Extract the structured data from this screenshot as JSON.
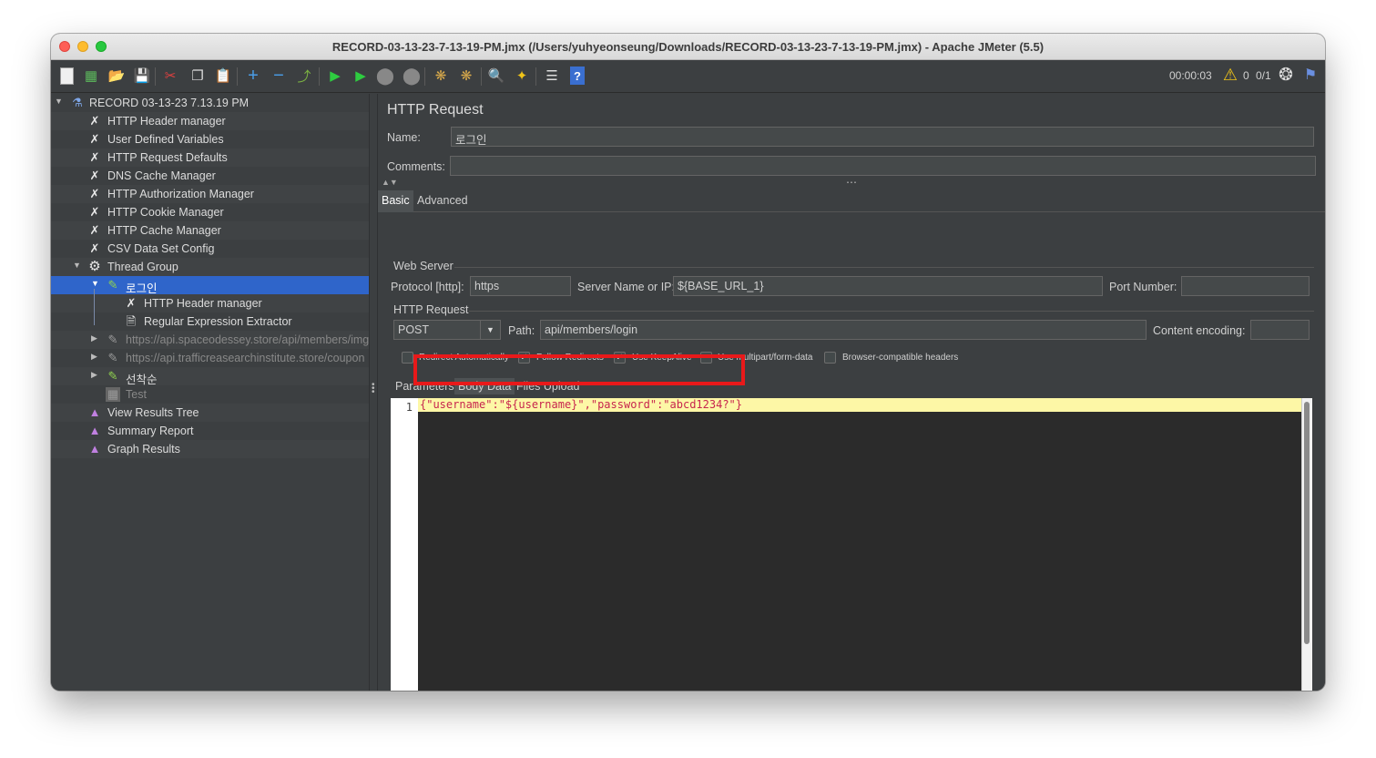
{
  "window": {
    "title": "RECORD-03-13-23-7-13-19-PM.jmx (/Users/yuhyeonseung/Downloads/RECORD-03-13-23-7-13-19-PM.jmx) - Apache JMeter (5.5)"
  },
  "toolbar": {
    "timer": "00:00:03",
    "warn_count": "0",
    "threads": "0/1"
  },
  "tree": {
    "root": "RECORD 03-13-23 7.13.19 PM",
    "items": [
      {
        "label": "HTTP Header manager"
      },
      {
        "label": "User Defined Variables"
      },
      {
        "label": "HTTP Request Defaults"
      },
      {
        "label": "DNS Cache Manager"
      },
      {
        "label": "HTTP Authorization Manager"
      },
      {
        "label": "HTTP Cookie Manager"
      },
      {
        "label": "HTTP Cache Manager"
      },
      {
        "label": "CSV Data Set Config"
      },
      {
        "label": "Thread Group"
      },
      {
        "label": "로그인"
      },
      {
        "label": "HTTP Header manager"
      },
      {
        "label": "Regular Expression Extractor"
      },
      {
        "label": "https://api.spaceodessey.store/api/members/img"
      },
      {
        "label": "https://api.trafficreasearchinstitute.store/coupon"
      },
      {
        "label": "선착순"
      },
      {
        "label": "Test"
      },
      {
        "label": "View Results Tree"
      },
      {
        "label": "Summary Report"
      },
      {
        "label": "Graph Results"
      }
    ]
  },
  "panel": {
    "title": "HTTP Request",
    "name_label": "Name:",
    "name_value": "로그인",
    "comments_label": "Comments:",
    "comments_value": "",
    "tabs": [
      "Basic",
      "Advanced"
    ],
    "web_server_section": "Web Server",
    "protocol_label": "Protocol [http]:",
    "protocol_value": "https",
    "server_label": "Server Name or IP:",
    "server_value": "${BASE_URL_1}",
    "port_label": "Port Number:",
    "port_value": "",
    "http_request_section": "HTTP Request",
    "method": "POST",
    "path_label": "Path:",
    "path_value": "api/members/login",
    "encoding_label": "Content encoding:",
    "encoding_value": "",
    "checkboxes": [
      {
        "label": "Redirect Automatically",
        "checked": false
      },
      {
        "label": "Follow Redirects",
        "checked": true
      },
      {
        "label": "Use KeepAlive",
        "checked": true
      },
      {
        "label": "Use multipart/form-data",
        "checked": false
      },
      {
        "label": "Browser-compatible headers",
        "checked": false
      }
    ],
    "subtabs": [
      "Parameters",
      "Body Data",
      "Files Upload"
    ],
    "line_number": "1",
    "body": "{\"username\":\"${username}\",\"password\":\"abcd1234?\"}"
  },
  "colors": {
    "highlight_box": "#e8191a",
    "selection": "#2f65ca",
    "background": "#3c3f41"
  }
}
